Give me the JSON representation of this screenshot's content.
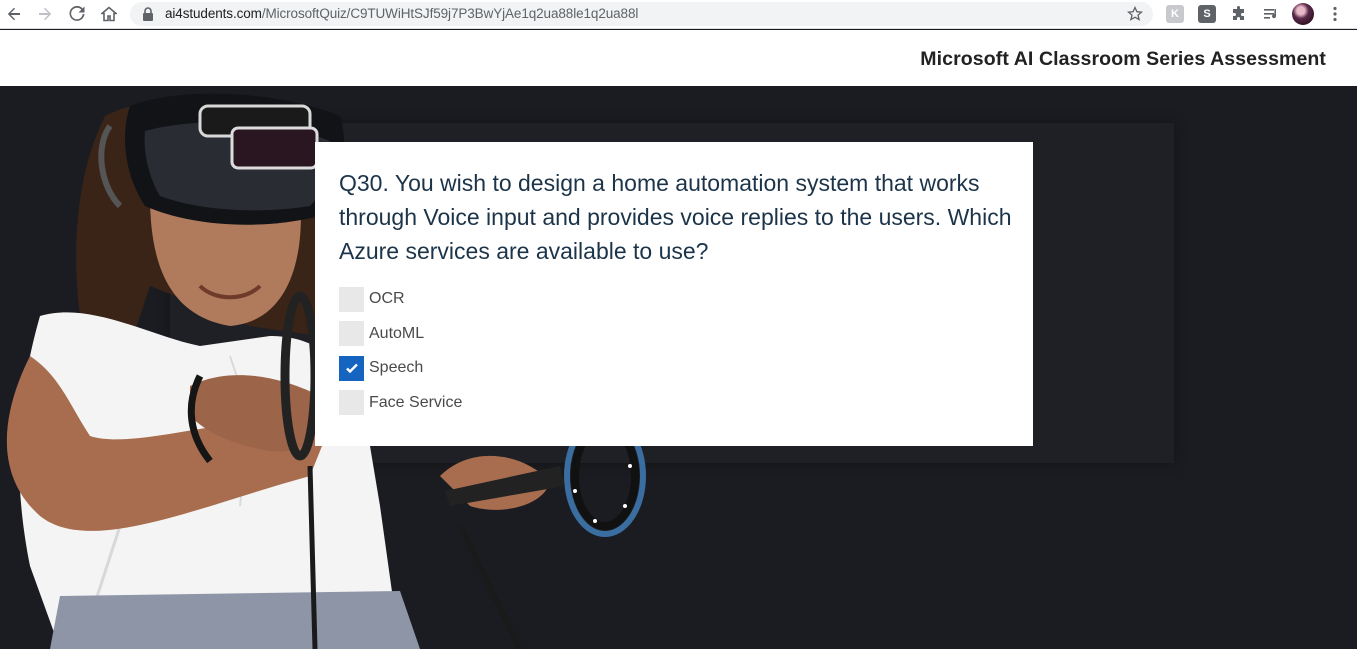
{
  "browser": {
    "url_host": "ai4students.com",
    "url_path": "/MicrosoftQuiz/C9TUWiHtSJf59j7P3BwYjAe1q2ua88le1q2ua88l",
    "extensions": [
      {
        "name": "k-extension",
        "label": "K"
      },
      {
        "name": "s-extension",
        "label": "S"
      }
    ]
  },
  "header": {
    "title": "Microsoft AI Classroom Series Assessment"
  },
  "quiz": {
    "question": "Q30. You wish to design a home automation system that works through Voice input and provides voice replies to the users. Which Azure services are available to use?",
    "options": [
      {
        "label": "OCR",
        "checked": false
      },
      {
        "label": "AutoML",
        "checked": false
      },
      {
        "label": "Speech",
        "checked": true
      },
      {
        "label": "Face Service",
        "checked": false
      }
    ]
  },
  "colors": {
    "accent": "#1565c0",
    "question_text": "#1c3449",
    "background": "#1b1c21"
  }
}
